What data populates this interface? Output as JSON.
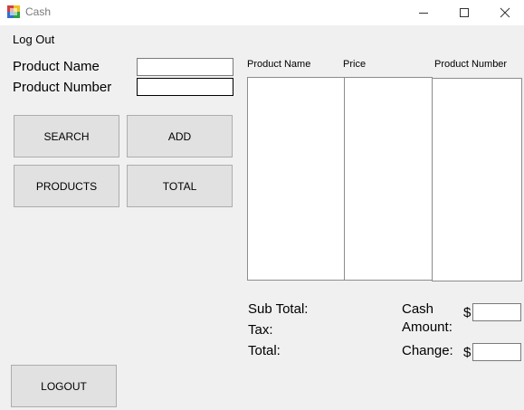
{
  "window": {
    "title": "Cash"
  },
  "menu": {
    "logout": "Log Out"
  },
  "form": {
    "product_name_label": "Product Name",
    "product_number_label": "Product Number",
    "product_name_value": "",
    "product_number_value": ""
  },
  "buttons": {
    "search": "SEARCH",
    "add": "ADD",
    "products": "PRODUCTS",
    "total": "TOTAL",
    "logout": "LOGOUT"
  },
  "table": {
    "columns": [
      "Product Name",
      "Price",
      "Product Number"
    ]
  },
  "summary": {
    "subtotal_label": "Sub Total:",
    "tax_label": "Tax:",
    "total_label": "Total:",
    "cash_amount_label_1": "Cash",
    "cash_amount_label_2": "Amount:",
    "change_label": "Change:",
    "currency": "$",
    "cash_amount_value": "",
    "change_value": ""
  }
}
